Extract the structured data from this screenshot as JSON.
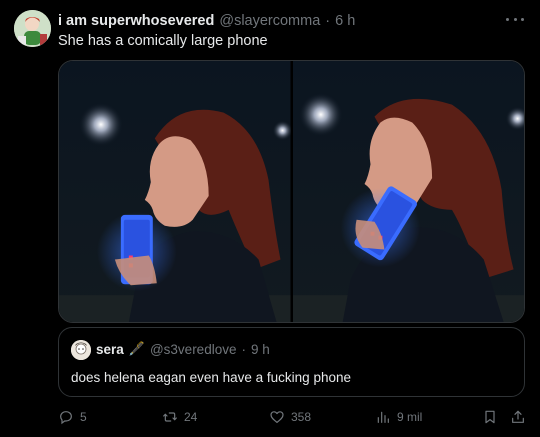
{
  "tweet": {
    "display_name": "i am superwhosevered",
    "handle": "@slayercomma",
    "separator": "·",
    "time": "6 h",
    "text": "She has a comically large phone",
    "more_icon": "more-horizontal-icon"
  },
  "media": {
    "frames": 2
  },
  "quote": {
    "display_name": "sera",
    "emoji": "🖋️",
    "handle": "@s3veredlove",
    "separator": "·",
    "time": "9 h",
    "text": "does helena eagan even have a fucking phone"
  },
  "actions": {
    "replies": "5",
    "retweets": "24",
    "likes": "358",
    "views": "9 mil"
  },
  "colors": {
    "background": "#000000",
    "text": "#e7e9ea",
    "muted": "#71767b",
    "border": "#2f3336",
    "phone_glow": "#3a6cff"
  }
}
